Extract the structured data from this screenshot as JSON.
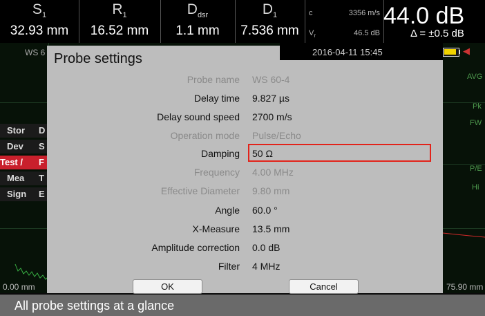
{
  "header": {
    "measurements": [
      {
        "label_main": "S",
        "label_sub": "1",
        "value": "32.93 mm"
      },
      {
        "label_main": "R",
        "label_sub": "1",
        "value": "16.52 mm"
      },
      {
        "label_main": "D",
        "label_sub": "dsr",
        "value": "1.1 mm"
      },
      {
        "label_main": "D",
        "label_sub": "1",
        "value": "7.536 mm"
      }
    ],
    "c_label": "c",
    "c_value": "3356 m/s",
    "v_label": "V",
    "v_label_sub": "r",
    "v_value": "46.5 dB",
    "gain": "44.0 dB",
    "delta": "Δ = ±0.5 dB"
  },
  "status": {
    "probe_tag": "WS 6",
    "datetime": "2016-04-11 15:45",
    "speaker_icon": "speaker-mute-icon",
    "battery_icon": "battery-icon"
  },
  "right_labels": [
    "AVG",
    "Pk",
    "FW",
    "P/E",
    "Hi"
  ],
  "left_menu": [
    {
      "col1": "Stor",
      "col2": "D",
      "selected": false
    },
    {
      "col1": "Dev",
      "col2": "S",
      "selected": false
    },
    {
      "col1": "Test /",
      "col2": "F",
      "selected": true
    },
    {
      "col1": "Mea",
      "col2": "T",
      "selected": false
    },
    {
      "col1": "Sign",
      "col2": "E",
      "selected": false
    }
  ],
  "axis": {
    "left": "0.00 mm",
    "right": "75.90 mm"
  },
  "dialog": {
    "title": "Probe settings",
    "rows": [
      {
        "label": "Probe name",
        "value": "WS 60-4",
        "enabled": false
      },
      {
        "label": "Delay time",
        "value": "9.827 µs",
        "enabled": true
      },
      {
        "label": "Delay sound speed",
        "value": "2700 m/s",
        "enabled": true
      },
      {
        "label": "Operation mode",
        "value": "Pulse/Echo",
        "enabled": false
      },
      {
        "label": "Damping",
        "value": "50 Ω",
        "enabled": true,
        "highlighted": true
      },
      {
        "label": "Frequency",
        "value": "4.00 MHz",
        "enabled": false
      },
      {
        "label": "Effective Diameter",
        "value": "9.80 mm",
        "enabled": false
      },
      {
        "label": "Angle",
        "value": "60.0 °",
        "enabled": true
      },
      {
        "label": "X-Measure",
        "value": "13.5 mm",
        "enabled": true
      },
      {
        "label": "Amplitude correction",
        "value": "0.0 dB",
        "enabled": true
      },
      {
        "label": "Filter",
        "value": "4 MHz",
        "enabled": true
      }
    ],
    "ok_label": "OK",
    "cancel_label": "Cancel"
  },
  "caption": "All probe settings at a glance",
  "colors": {
    "accent_red": "#c9202c",
    "highlight_border": "#e2231a",
    "battery": "#f2d400"
  }
}
